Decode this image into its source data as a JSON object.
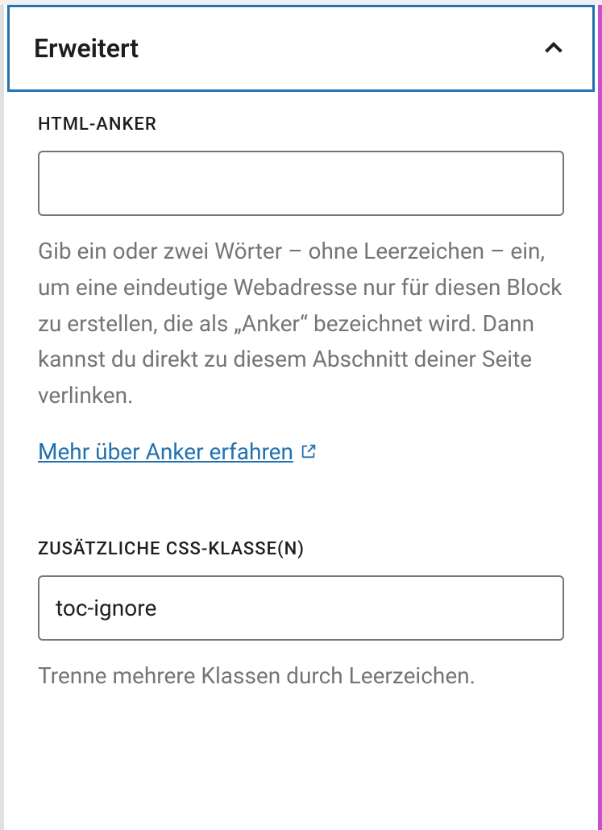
{
  "panel": {
    "title": "Erweitert"
  },
  "anchor": {
    "label": "HTML-ANKER",
    "value": "",
    "help": "Gib ein oder zwei Wörter – ohne Leerzeichen – ein, um eine eindeutige Webadresse nur für diesen Block zu erstellen, die als „Anker“ bezeichnet wird. Dann kannst du direkt zu diesem Abschnitt deiner Seite verlinken.",
    "link_text": "Mehr über Anker erfahren"
  },
  "css": {
    "label": "ZUSÄTZLICHE CSS-KLASSE(N)",
    "value": "toc-ignore",
    "help": "Trenne mehrere Klassen durch Leerzeichen."
  }
}
